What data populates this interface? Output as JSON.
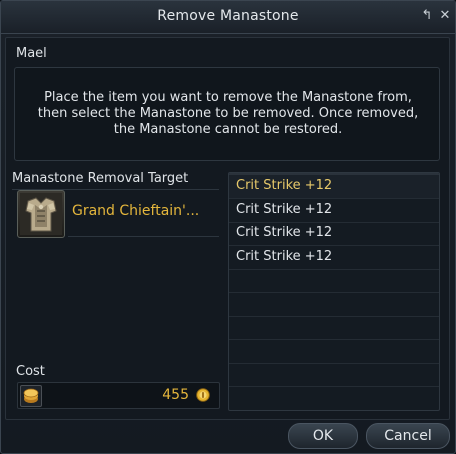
{
  "window": {
    "title": "Remove Manastone",
    "pin_icon": "↰",
    "close_icon": "✕"
  },
  "npc_name": "Mael",
  "description": "Place the item you want to remove the Manastone from, then select the Manastone to be removed. Once removed, the Manastone cannot be restored.",
  "target": {
    "label": "Manastone Removal Target",
    "item_name": "Grand Chieftain'...",
    "item_icon": "chieftain-armor-icon"
  },
  "cost": {
    "label": "Cost",
    "value": "455",
    "coin_icon": "kinah-coin-icon"
  },
  "manastones": [
    {
      "label": "Crit Strike +12",
      "selected": true
    },
    {
      "label": "Crit Strike +12",
      "selected": false
    },
    {
      "label": "Crit Strike +12",
      "selected": false
    },
    {
      "label": "Crit Strike +12",
      "selected": false
    }
  ],
  "empty_rows": 5,
  "buttons": {
    "ok": "OK",
    "cancel": "Cancel"
  },
  "colors": {
    "accent_gold": "#e4b63c",
    "selected_text": "#e7c96a"
  }
}
